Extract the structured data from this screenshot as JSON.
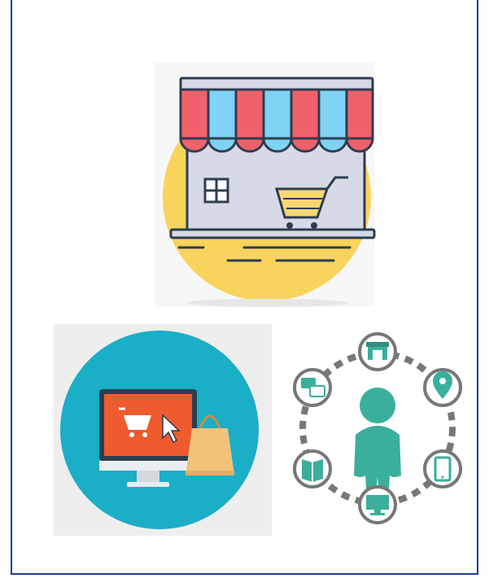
{
  "colors": {
    "frame_border": "#1f3a93",
    "awning_red": "#f1616b",
    "awning_blue": "#7fd3f5",
    "store_wall": "#d6dae6",
    "outline": "#2e3d50",
    "sun_yellow": "#f9d45c",
    "cart_yellow": "#f7d774",
    "ecom_circle": "#1baec7",
    "monitor_screen": "#ef5b2e",
    "bag_tan": "#f2c27b",
    "omni_teal": "#3aaf9c",
    "dash_gray": "#777777"
  },
  "icons": {
    "storefront": "storefront-icon",
    "ecommerce": "online-shopping-icon",
    "omnichannel": "omnichannel-customer-icon",
    "store_small": "store-icon",
    "location": "location-pin-icon",
    "phone": "smartphone-icon",
    "desktop": "desktop-icon",
    "catalog": "catalog-book-icon",
    "chat": "chat-bubbles-icon"
  }
}
